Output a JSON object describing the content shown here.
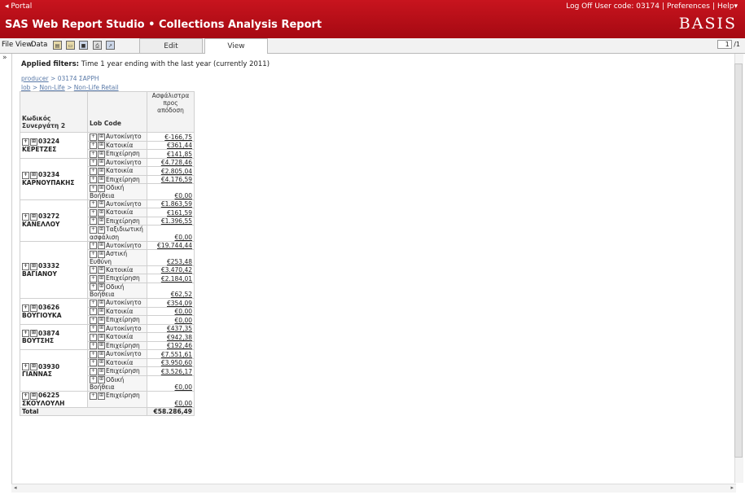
{
  "header": {
    "portal_link": "◂ Portal",
    "app_title": "SAS Web Report Studio  •  Collections Analysis Report",
    "logoff": "Log Off User code: 03174",
    "preferences": "Preferences",
    "help": "Help▾",
    "logo": "BASIS"
  },
  "menubar": {
    "file": "File",
    "view": "View",
    "data": "Data",
    "tabs": {
      "edit": "Edit",
      "view": "View"
    },
    "page_current": "1",
    "page_total": "/1"
  },
  "icons": [
    "folder-open-icon",
    "open-icon",
    "save-icon",
    "print-icon",
    "export-icon"
  ],
  "collapse_label": "»",
  "filters": {
    "label": "Applied filters:",
    "text": " Time 1 year ending with the last year (currently 2011)"
  },
  "breadcrumbs": {
    "first": {
      "link": "producer",
      "sep": ">",
      "value": "03174 ΣΑΡΡΗ"
    },
    "second": {
      "link": "lob",
      "sep": ">",
      "value1": "Non-Life",
      "value2": "Non-Life Retail"
    }
  },
  "table": {
    "headers": {
      "agent": "Κωδικός Συνεργάτη 2",
      "lob": "Lob Code",
      "premium": "Ασφάλιστρα προς απόδοση"
    },
    "groups": [
      {
        "agent": "03224 ΚΕΡΕΤΖΕΣ",
        "rows": [
          {
            "lob": "Αυτοκίνητο",
            "value": "€-166,75"
          },
          {
            "lob": "Κατοικία",
            "value": "€361,44"
          },
          {
            "lob": "Επιχείρηση",
            "value": "€141,85"
          }
        ]
      },
      {
        "agent": "03234 ΚΑΡΝΟΥΠΑΚΗΣ",
        "rows": [
          {
            "lob": "Αυτοκίνητο",
            "value": "€4.728,46"
          },
          {
            "lob": "Κατοικία",
            "value": "€2.805,04"
          },
          {
            "lob": "Επιχείρηση",
            "value": "€4.176,59"
          },
          {
            "lob": "Οδική Βοήθεια",
            "value": "€0,00"
          }
        ]
      },
      {
        "agent": "03272 ΚΑΝΕΛΛΟΥ",
        "rows": [
          {
            "lob": "Αυτοκίνητο",
            "value": "€1.863,59"
          },
          {
            "lob": "Κατοικία",
            "value": "€161,59"
          },
          {
            "lob": "Επιχείρηση",
            "value": "€1.396,55"
          },
          {
            "lob": "Ταξιδιωτική ασφάλιση",
            "value": "€0,00"
          }
        ]
      },
      {
        "agent": "03332 ΒΑΓΙΑΝΟΥ",
        "rows": [
          {
            "lob": "Αυτοκίνητο",
            "value": "€19.744,44"
          },
          {
            "lob": "Αστική Ευθύνη",
            "value": "€253,48"
          },
          {
            "lob": "Κατοικία",
            "value": "€3.470,42"
          },
          {
            "lob": "Επιχείρηση",
            "value": "€2.184,01"
          },
          {
            "lob": "Οδική Βοήθεια",
            "value": "€62,52"
          }
        ]
      },
      {
        "agent": "03626 ΒΟΥΓΙΟΥΚΑ",
        "rows": [
          {
            "lob": "Αυτοκίνητο",
            "value": "€354,09"
          },
          {
            "lob": "Κατοικία",
            "value": "€0,00"
          },
          {
            "lob": "Επιχείρηση",
            "value": "€0,00"
          }
        ]
      },
      {
        "agent": "03874 ΒΟΥΤΣΗΣ",
        "rows": [
          {
            "lob": "Αυτοκίνητο",
            "value": "€437,35"
          },
          {
            "lob": "Κατοικία",
            "value": "€942,38"
          },
          {
            "lob": "Επιχείρηση",
            "value": "€192,46"
          }
        ]
      },
      {
        "agent": "03930 ΓΙΑΝΝΑΣ",
        "rows": [
          {
            "lob": "Αυτοκίνητο",
            "value": "€7.551,61"
          },
          {
            "lob": "Κατοικία",
            "value": "€3.950,60"
          },
          {
            "lob": "Επιχείρηση",
            "value": "€3.526,17"
          },
          {
            "lob": "Οδική Βοήθεια",
            "value": "€0,00"
          }
        ]
      },
      {
        "agent": "06225 ΣΚΟΥΛΟΥΛΗ",
        "rows": [
          {
            "lob": "Επιχείρηση",
            "value": "€0,00"
          }
        ]
      }
    ],
    "total_label": "Total",
    "total_value": "€58.286,49"
  },
  "colors": {
    "header_red": "#b40d16",
    "link_blue": "#5a7aa8"
  }
}
